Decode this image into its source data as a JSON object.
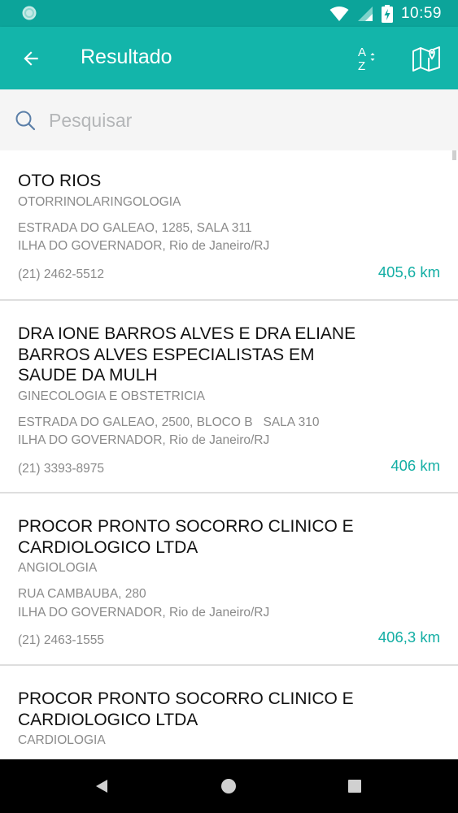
{
  "status_bar": {
    "time": "10:59"
  },
  "app_bar": {
    "title": "Resultado",
    "sort_letter_top": "A",
    "sort_letter_bottom": "Z"
  },
  "search": {
    "placeholder": "Pesquisar",
    "value": ""
  },
  "results": [
    {
      "name": "OTO RIOS",
      "specialty": "OTORRINOLARINGOLOGIA",
      "address_line1": "ESTRADA DO GALEAO, 1285, SALA 311",
      "address_line2": "ILHA DO GOVERNADOR, Rio de Janeiro/RJ",
      "phone": "(21) 2462-5512",
      "distance": "405,6 km"
    },
    {
      "name": "DRA  IONE BARROS ALVES E DRA  ELIANE BARROS ALVES ESPECIALISTAS EM SAUDE DA MULH",
      "specialty": "GINECOLOGIA E OBSTETRICIA",
      "address_line1": "ESTRADA DO GALEAO, 2500, BLOCO B   SALA 310",
      "address_line2": "ILHA DO GOVERNADOR, Rio de Janeiro/RJ",
      "phone": "(21) 3393-8975",
      "distance": "406 km"
    },
    {
      "name": "PROCOR PRONTO SOCORRO CLINICO E CARDIOLOGICO LTDA",
      "specialty": "ANGIOLOGIA",
      "address_line1": "RUA CAMBAUBA, 280",
      "address_line2": "ILHA DO GOVERNADOR, Rio de Janeiro/RJ",
      "phone": "(21) 2463-1555",
      "distance": "406,3 km"
    },
    {
      "name": "PROCOR PRONTO SOCORRO CLINICO E CARDIOLOGICO LTDA",
      "specialty": "CARDIOLOGIA",
      "address_line1": "",
      "address_line2": "",
      "phone": "",
      "distance": ""
    }
  ],
  "colors": {
    "status_bar": "#0ca49a",
    "app_bar": "#13b5aa",
    "accent_distance": "#13aea4"
  }
}
